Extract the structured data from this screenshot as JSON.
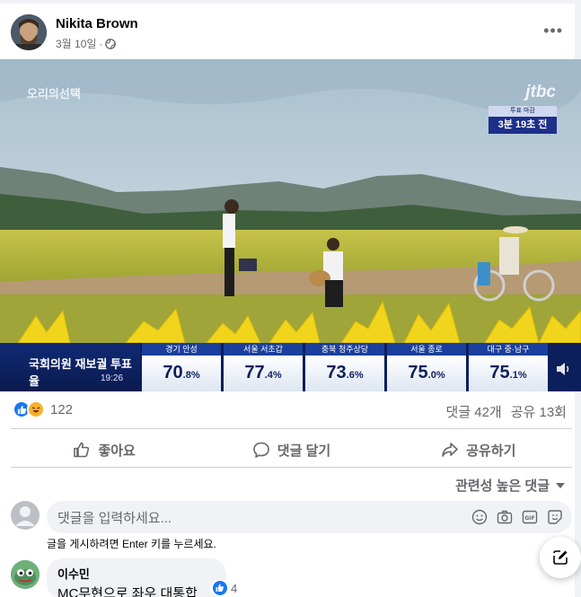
{
  "post": {
    "author": "Nikita Brown",
    "date": "3월 10일",
    "more_label": "•••"
  },
  "video": {
    "top_left_logo": "오리의선택",
    "channel_logo": "jtbc",
    "countdown": {
      "label": "투표 마감",
      "value": "3분 19초 전"
    },
    "ticker": {
      "title": "국회의원 재보궐 투표율",
      "time": "19:26",
      "districts": [
        {
          "name": "경기 안성",
          "value": "70",
          "decimal": ".8%"
        },
        {
          "name": "서울 서초갑",
          "value": "77",
          "decimal": ".4%"
        },
        {
          "name": "충북 청주상당",
          "value": "73",
          "decimal": ".6%"
        },
        {
          "name": "서울 종로",
          "value": "75",
          "decimal": ".0%"
        },
        {
          "name": "대구 중·남구",
          "value": "75",
          "decimal": ".1%"
        }
      ]
    }
  },
  "engagement": {
    "reaction_count": "122",
    "comments": "댓글 42개",
    "shares": "공유 13회"
  },
  "actions": {
    "like": "좋아요",
    "comment": "댓글 달기",
    "share": "공유하기"
  },
  "comments_sort": "관련성 높은 댓글",
  "comment_box": {
    "placeholder": "댓글을 입력하세요...",
    "hint": "글을 게시하려면 Enter 키를 누르세요."
  },
  "comment": {
    "author": "이수민",
    "text": "MC무현으로 좌우 대통합",
    "likes": "4"
  },
  "colors": {
    "facebook_blue": "#1877f2",
    "ticker_navy": "#0b1f5c"
  }
}
